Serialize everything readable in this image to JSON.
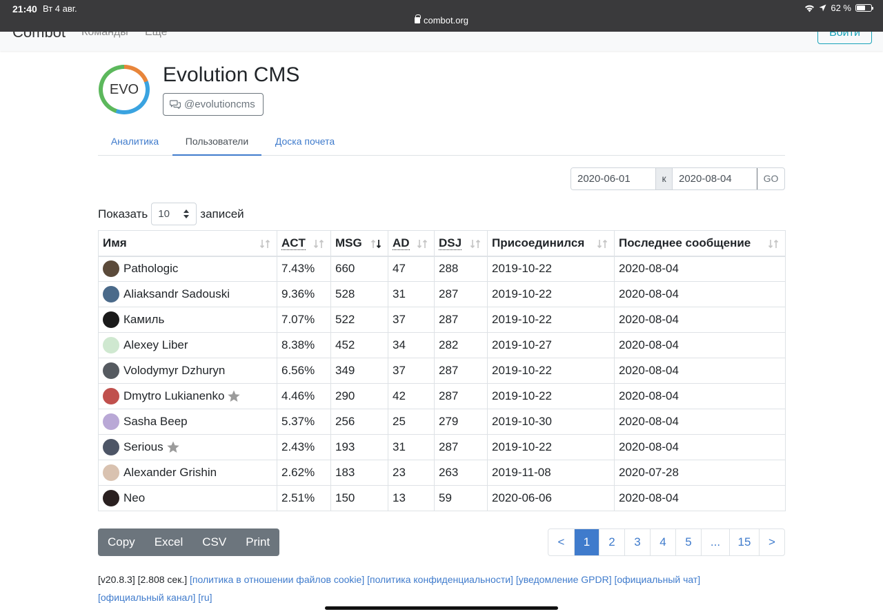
{
  "status_bar": {
    "time": "21:40",
    "date": "Вт 4 авг.",
    "url": "combot.org",
    "battery": "62 %",
    "battery_level": 0.62
  },
  "navbar": {
    "brand": "Combot",
    "nav_commands": "Команды",
    "nav_more": "Еще",
    "login": "Войти"
  },
  "header": {
    "logo_text": "EVO",
    "title": "Evolution CMS",
    "handle": "@evolutioncms"
  },
  "tabs": [
    {
      "label": "Аналитика",
      "active": false
    },
    {
      "label": "Пользователи",
      "active": true
    },
    {
      "label": "Доска почета",
      "active": false
    }
  ],
  "date_filter": {
    "from": "2020-06-01",
    "separator": "к",
    "to": "2020-08-04",
    "go": "GO"
  },
  "length": {
    "prefix": "Показать",
    "value": "10",
    "suffix": "записей"
  },
  "table": {
    "columns": [
      "Имя",
      "ACT",
      "MSG",
      "AD",
      "DSJ",
      "Присоединился",
      "Последнее сообщение"
    ],
    "rows": [
      {
        "name": "Pathologic",
        "act": "7.43%",
        "msg": "660",
        "ad": "47",
        "dsj": "288",
        "joined": "2019-10-22",
        "last": "2020-08-04",
        "star": false,
        "avatar_color": "#5b4a3a"
      },
      {
        "name": "Aliaksandr Sadouski",
        "act": "9.36%",
        "msg": "528",
        "ad": "31",
        "dsj": "287",
        "joined": "2019-10-22",
        "last": "2020-08-04",
        "star": false,
        "avatar_color": "#4a6a8a"
      },
      {
        "name": "Камиль",
        "act": "7.07%",
        "msg": "522",
        "ad": "37",
        "dsj": "287",
        "joined": "2019-10-22",
        "last": "2020-08-04",
        "star": false,
        "avatar_color": "#1a1a1a"
      },
      {
        "name": "Alexey Liber",
        "act": "8.38%",
        "msg": "452",
        "ad": "34",
        "dsj": "282",
        "joined": "2019-10-27",
        "last": "2020-08-04",
        "star": false,
        "avatar_color": "#cfe8d0"
      },
      {
        "name": "Volodymyr Dzhuryn",
        "act": "6.56%",
        "msg": "349",
        "ad": "37",
        "dsj": "287",
        "joined": "2019-10-22",
        "last": "2020-08-04",
        "star": false,
        "avatar_color": "#555a60"
      },
      {
        "name": "Dmytro Lukianenko",
        "act": "4.46%",
        "msg": "290",
        "ad": "42",
        "dsj": "287",
        "joined": "2019-10-22",
        "last": "2020-08-04",
        "star": true,
        "avatar_color": "#c0504d"
      },
      {
        "name": "Sasha Beep",
        "act": "5.37%",
        "msg": "256",
        "ad": "25",
        "dsj": "279",
        "joined": "2019-10-30",
        "last": "2020-08-04",
        "star": false,
        "avatar_color": "#b9a8d6"
      },
      {
        "name": "Serious",
        "act": "2.43%",
        "msg": "193",
        "ad": "31",
        "dsj": "287",
        "joined": "2019-10-22",
        "last": "2020-08-04",
        "star": true,
        "avatar_color": "#4d5566"
      },
      {
        "name": "Alexander Grishin",
        "act": "2.62%",
        "msg": "183",
        "ad": "23",
        "dsj": "263",
        "joined": "2019-11-08",
        "last": "2020-07-28",
        "star": false,
        "avatar_color": "#d9c2b0"
      },
      {
        "name": "Neo",
        "act": "2.51%",
        "msg": "150",
        "ad": "13",
        "dsj": "59",
        "joined": "2020-06-06",
        "last": "2020-08-04",
        "star": false,
        "avatar_color": "#2a2020"
      }
    ]
  },
  "export_buttons": [
    "Copy",
    "Excel",
    "CSV",
    "Print"
  ],
  "pagination": [
    "<",
    "1",
    "2",
    "3",
    "4",
    "5",
    "...",
    "15",
    ">"
  ],
  "pagination_active": "1",
  "footer": {
    "version": "[v20.8.3]",
    "time": "[2.808 сек.]",
    "links": [
      "[политика в отношении файлов cookie]",
      "[политика конфиденциальности]",
      "[уведомление GPDR]",
      "[официальный чат]",
      "[официальный канал]",
      "[ru]"
    ]
  },
  "colors": {
    "link": "#3f7bcc",
    "button_secondary": "#6c757d",
    "info": "#17a2b8"
  }
}
